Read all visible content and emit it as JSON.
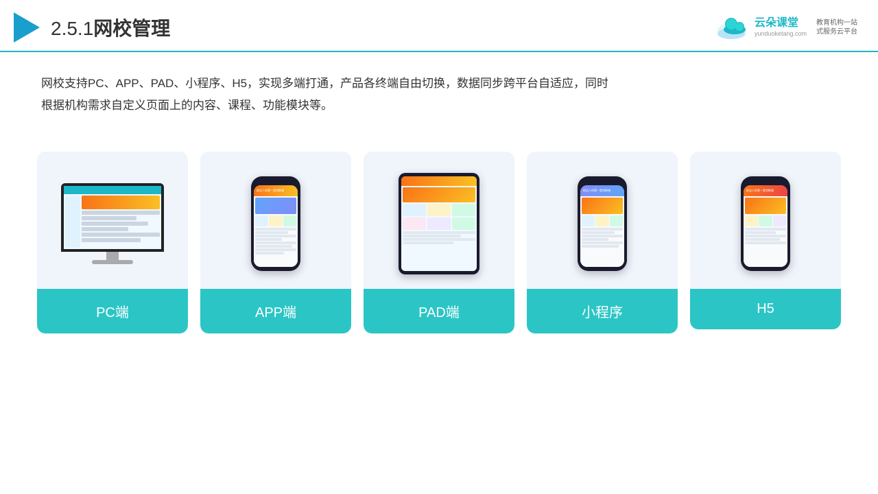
{
  "header": {
    "section_number": "2.5.1",
    "title_chinese": "网校管理",
    "logo": {
      "name": "云朵课堂",
      "url": "yunduoketang.com",
      "slogan_line1": "教育机构一站",
      "slogan_line2": "式服务云平台"
    }
  },
  "description": {
    "text": "网校支持PC、APP、PAD、小程序、H5，实现多端打通，产品各终端自由切换，数据同步跨平台自适应，同时根据机构需求自定义页面上的内容、课程、功能模块等。"
  },
  "devices": [
    {
      "id": "pc",
      "label": "PC端",
      "type": "pc"
    },
    {
      "id": "app",
      "label": "APP端",
      "type": "phone"
    },
    {
      "id": "pad",
      "label": "PAD端",
      "type": "pad"
    },
    {
      "id": "miniprogram",
      "label": "小程序",
      "type": "phone"
    },
    {
      "id": "h5",
      "label": "H5",
      "type": "phone"
    }
  ],
  "colors": {
    "teal": "#2cc5c5",
    "accent": "#1db8c8",
    "bg_card": "#f0f4fb"
  }
}
